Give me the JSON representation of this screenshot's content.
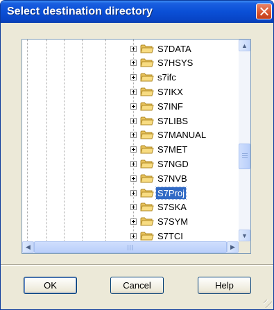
{
  "window": {
    "title": "Select destination directory",
    "close_label": "×",
    "titlebar_color": "#0a4fd6",
    "selection_color": "#316ac5"
  },
  "tree": {
    "items": [
      {
        "label": "S7DATA",
        "icon": "folder-icon",
        "expanded": false,
        "selected": false
      },
      {
        "label": "S7HSYS",
        "icon": "folder-icon",
        "expanded": false,
        "selected": false
      },
      {
        "label": "s7ifc",
        "icon": "folder-icon",
        "expanded": false,
        "selected": false
      },
      {
        "label": "S7IKX",
        "icon": "folder-icon",
        "expanded": false,
        "selected": false
      },
      {
        "label": "S7INF",
        "icon": "folder-icon",
        "expanded": false,
        "selected": false
      },
      {
        "label": "S7LIBS",
        "icon": "folder-icon",
        "expanded": false,
        "selected": false
      },
      {
        "label": "S7MANUAL",
        "icon": "folder-icon",
        "expanded": false,
        "selected": false
      },
      {
        "label": "S7MET",
        "icon": "folder-icon",
        "expanded": false,
        "selected": false
      },
      {
        "label": "S7NGD",
        "icon": "folder-icon",
        "expanded": false,
        "selected": false
      },
      {
        "label": "S7NVB",
        "icon": "folder-icon",
        "expanded": false,
        "selected": false
      },
      {
        "label": "S7Proj",
        "icon": "folder-icon",
        "expanded": false,
        "selected": true
      },
      {
        "label": "S7SKA",
        "icon": "folder-icon",
        "expanded": false,
        "selected": false
      },
      {
        "label": "S7SYM",
        "icon": "folder-icon",
        "expanded": false,
        "selected": false
      },
      {
        "label": "S7TCI",
        "icon": "folder-icon",
        "expanded": false,
        "selected": false
      }
    ]
  },
  "scrollbars": {
    "up_arrow": "▲",
    "down_arrow": "▼",
    "left_arrow": "◀",
    "right_arrow": "▶"
  },
  "buttons": {
    "ok": "OK",
    "cancel": "Cancel",
    "help": "Help"
  }
}
